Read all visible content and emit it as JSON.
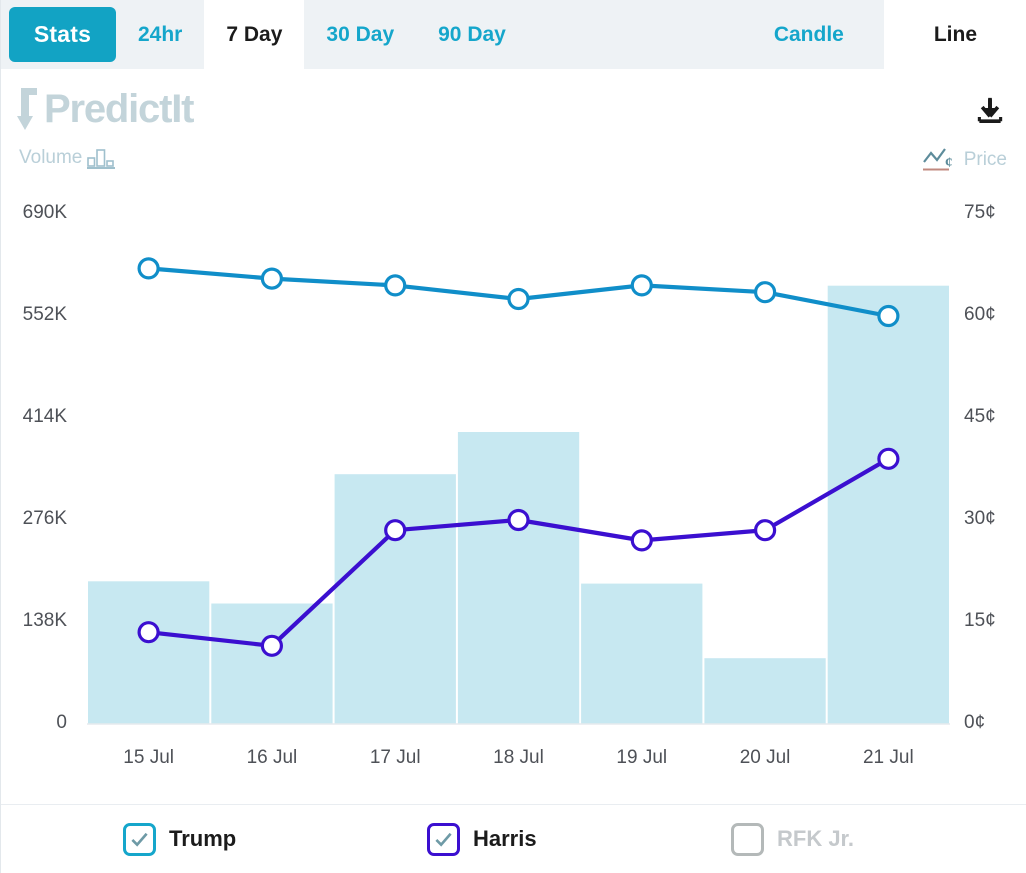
{
  "tabs": {
    "stats_label": "Stats",
    "ranges": [
      {
        "label": "24hr",
        "active": false
      },
      {
        "label": "7 Day",
        "active": true
      },
      {
        "label": "30 Day",
        "active": false
      },
      {
        "label": "90 Day",
        "active": false
      }
    ],
    "view_modes": [
      {
        "label": "Candle",
        "active": false
      },
      {
        "label": "Line",
        "active": true
      }
    ]
  },
  "brand": {
    "name": "PredictIt",
    "arrow_glyph": "↑",
    "color": "#c3d4da"
  },
  "toolbar": {
    "download_icon": "download-icon",
    "volume_label": "Volume",
    "volume_icon": "bar-chart-icon",
    "price_label": "Price",
    "price_icon": "line-chart-cent-icon"
  },
  "colors": {
    "tab_bar_bg": "#eef2f5",
    "stats_button": "#12a3c4",
    "tab_link": "#15a6cb",
    "volume_bar": "#c7e8f1",
    "trump_line": "#108ec9",
    "harris_line": "#3b0fd0",
    "axis_text": "#4e5157",
    "watermark": "#c3d4da",
    "disabled_text": "#c5c9cc"
  },
  "chart_data": {
    "type": "line",
    "title": "",
    "subtitle": "",
    "xlabel": "",
    "ylabel": "Volume",
    "y2label": "Price",
    "grid": false,
    "legend_position": "bottom",
    "categories": [
      "15 Jul",
      "16 Jul",
      "17 Jul",
      "18 Jul",
      "19 Jul",
      "20 Jul",
      "21 Jul"
    ],
    "x_tick_labels": [
      "15 Jul",
      "16 Jul",
      "17 Jul",
      "18 Jul",
      "19 Jul",
      "20 Jul",
      "21 Jul"
    ],
    "y_left_tick_labels": [
      "690K",
      "552K",
      "414K",
      "276K",
      "138K",
      "0"
    ],
    "y_left_tick_values": [
      690000,
      552000,
      414000,
      276000,
      138000,
      0
    ],
    "ylim": [
      0,
      690000
    ],
    "y_right_tick_labels": [
      "75¢",
      "60¢",
      "45¢",
      "30¢",
      "15¢",
      "0¢"
    ],
    "y_right_tick_values": [
      75,
      60,
      45,
      30,
      15,
      0
    ],
    "y2lim": [
      0,
      75
    ],
    "bars": {
      "name": "Volume",
      "axis": "left",
      "color": "#c7e8f1",
      "values": [
        193000,
        163000,
        338000,
        395000,
        190000,
        89000,
        593000
      ]
    },
    "series": [
      {
        "name": "Trump",
        "axis": "right",
        "unit": "¢",
        "color": "#108ec9",
        "enabled": true,
        "values": [
          67,
          65.5,
          64.5,
          62.5,
          64.5,
          63.5,
          60
        ]
      },
      {
        "name": "Harris",
        "axis": "right",
        "unit": "¢",
        "color": "#3b0fd0",
        "enabled": true,
        "values": [
          13.5,
          11.5,
          28.5,
          30,
          27,
          28.5,
          39
        ]
      },
      {
        "name": "RFK Jr.",
        "axis": "right",
        "unit": "¢",
        "color": "#b4b9b9",
        "enabled": false,
        "values": []
      }
    ]
  },
  "legend": [
    {
      "label": "Trump",
      "checked": true,
      "color": "#15a6cb",
      "disabled": false
    },
    {
      "label": "Harris",
      "checked": true,
      "color": "#3b0fd0",
      "disabled": false
    },
    {
      "label": "RFK Jr.",
      "checked": false,
      "color": "#b4b9b9",
      "disabled": true
    }
  ]
}
